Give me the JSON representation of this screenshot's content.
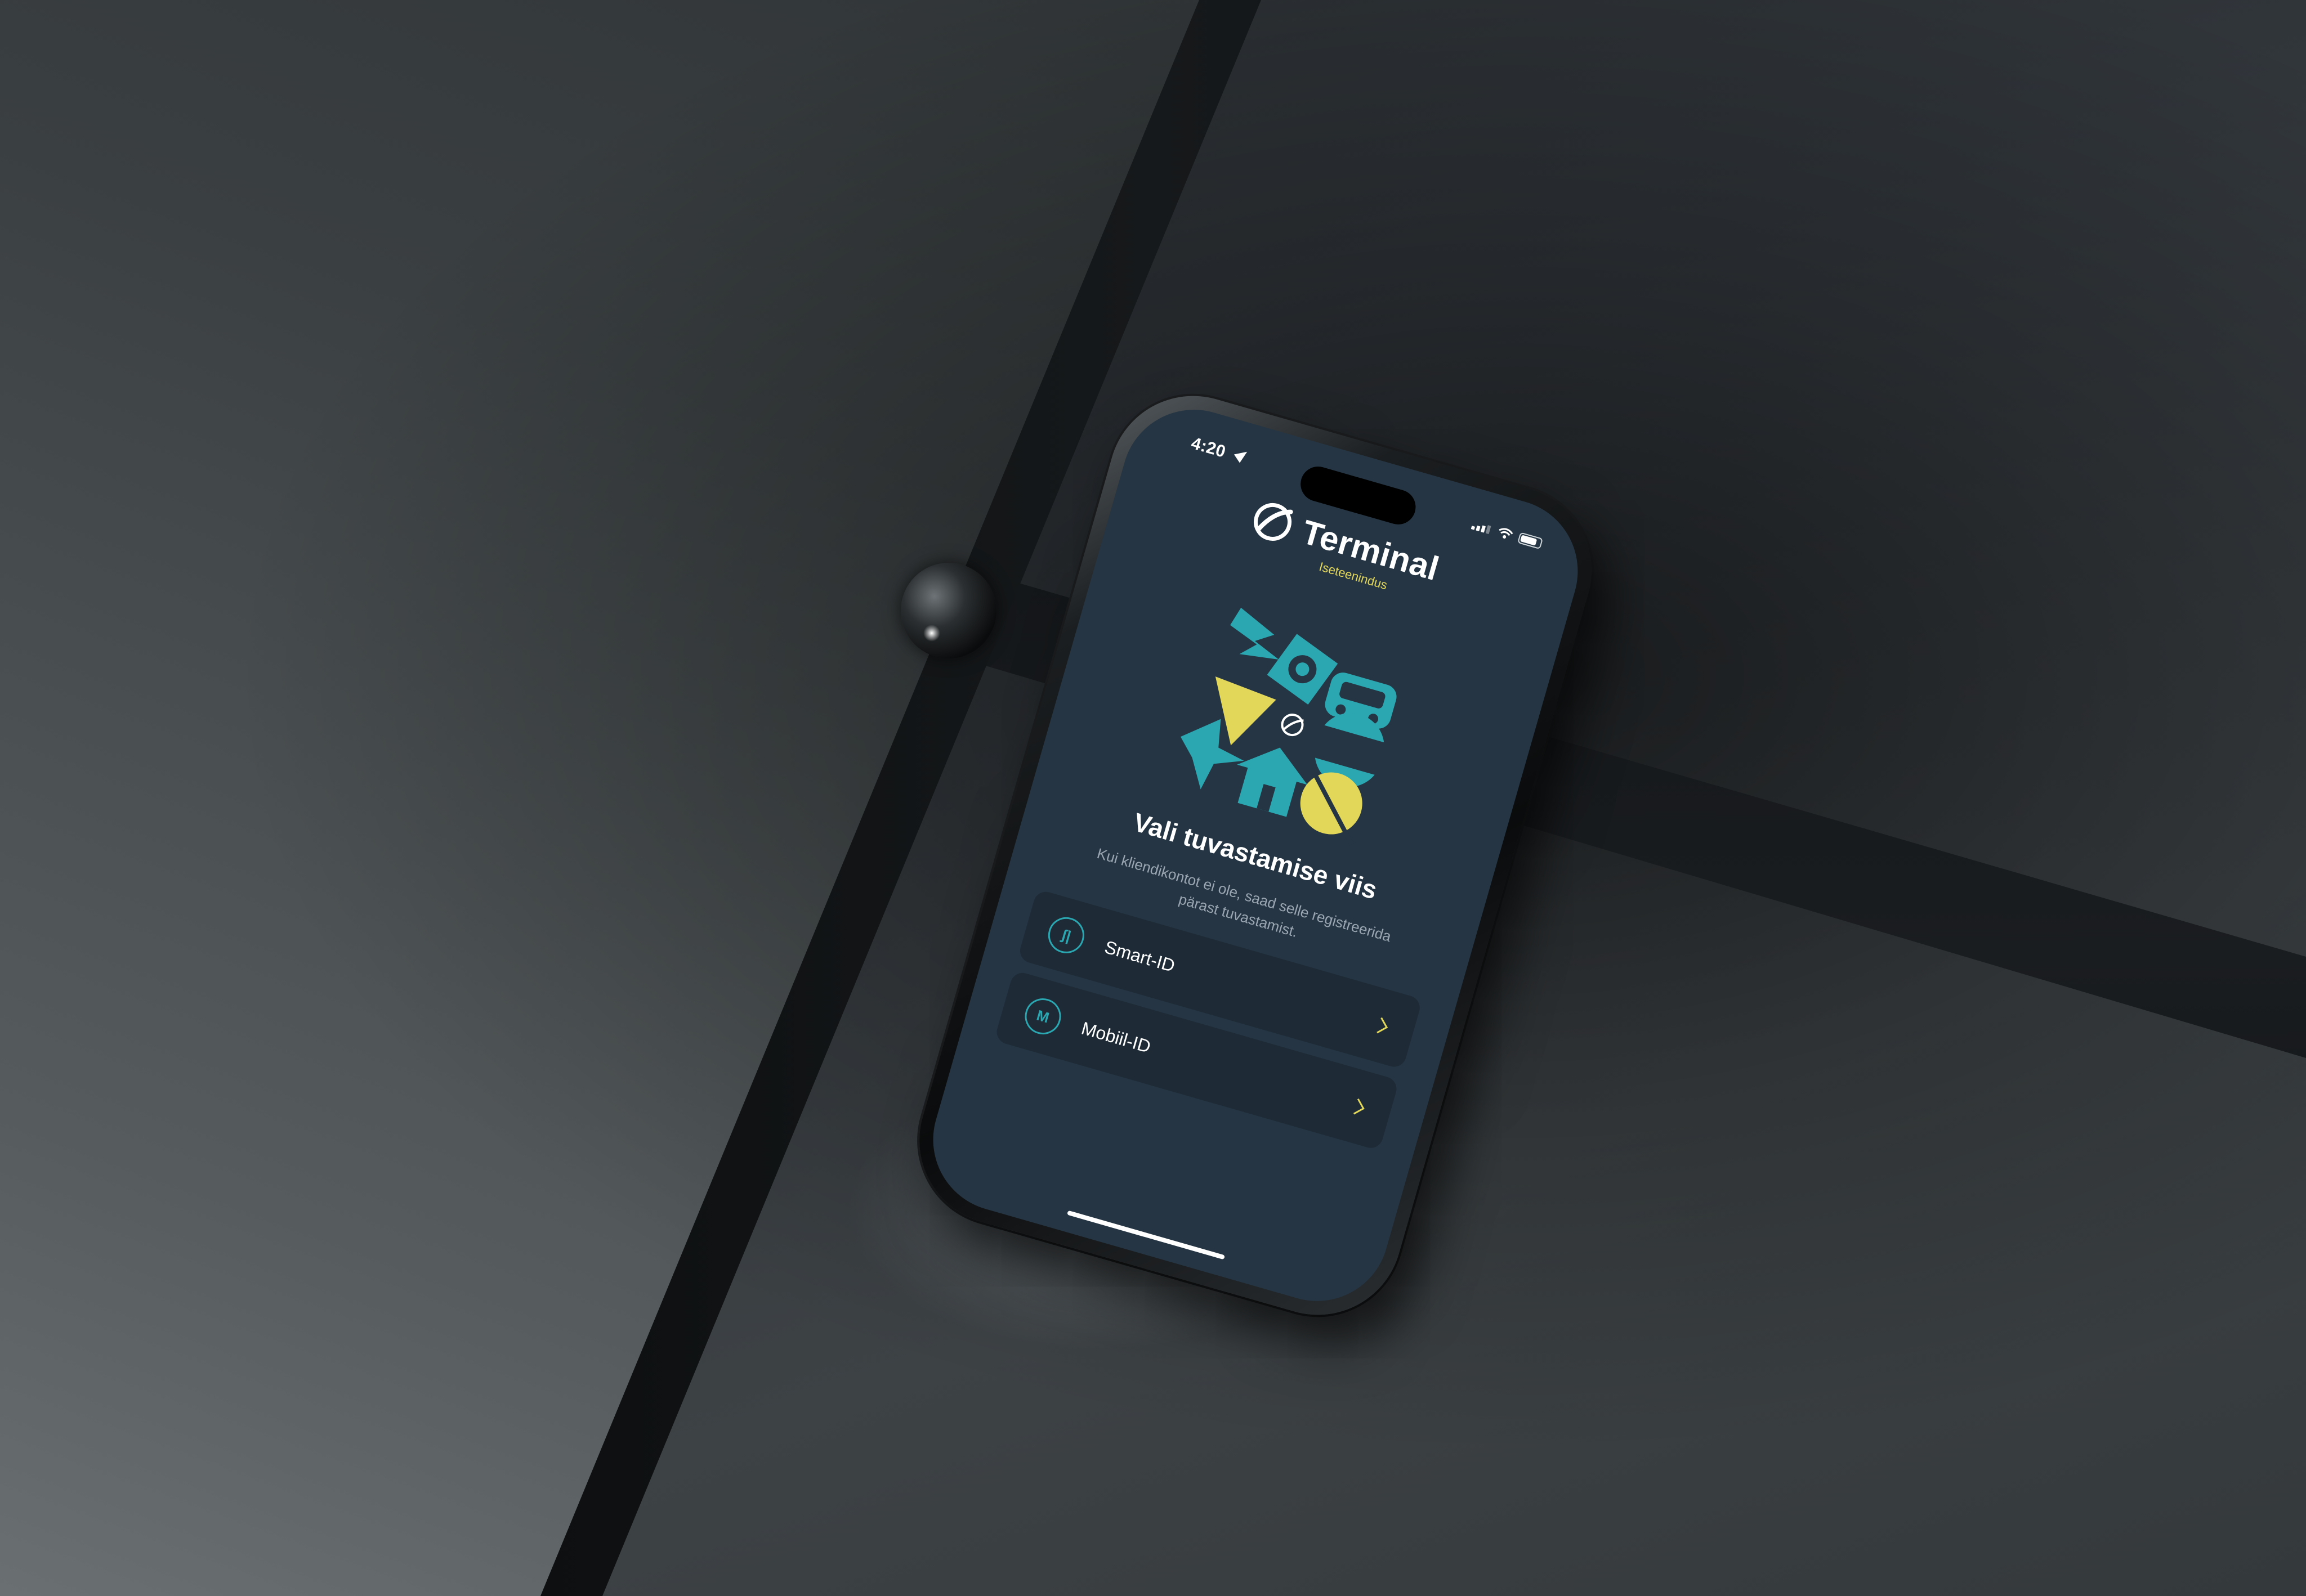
{
  "status_bar": {
    "time": "4:20"
  },
  "brand": {
    "name": "Terminal",
    "subtitle": "Iseteenindus",
    "accent_color": "#e3d75a",
    "teal_color": "#2aa7b1"
  },
  "screen": {
    "title": "Vali tuvastamise viis",
    "subtitle": "Kui kliendikontot ei ole, saad selle registreerida pärast tuvastamist.",
    "background_color": "#253543"
  },
  "options": [
    {
      "label": "Smart-ID",
      "icon": "smart-id-icon",
      "icon_text": "ʃ|"
    },
    {
      "label": "Mobiil-ID",
      "icon": "mobiil-id-icon",
      "icon_text": "M"
    }
  ]
}
